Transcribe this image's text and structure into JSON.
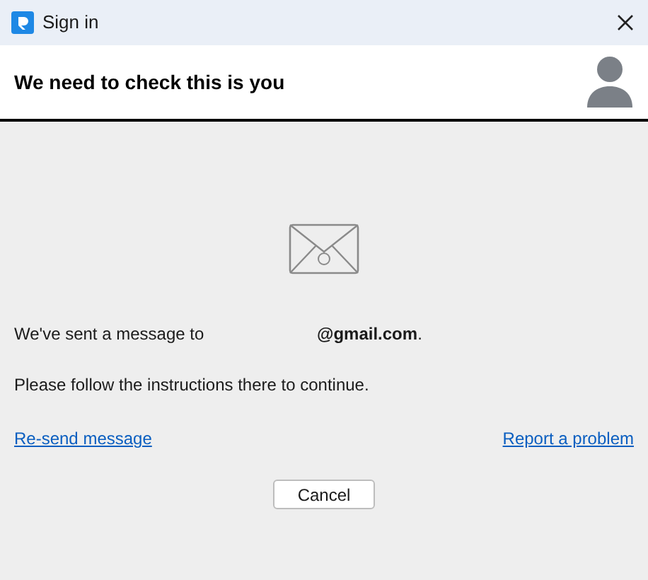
{
  "window": {
    "title": "Sign in"
  },
  "header": {
    "title": "We need to check this is you"
  },
  "message": {
    "prefix": "We've sent a message to",
    "email": "**@gmail.com**."
  },
  "instruction": "Please follow the instructions there to continue.",
  "links": [
    {
      "label": "Re-send message"
    },
    {
      "label": "Report a problem"
    }
  ],
  "buttons": [
    {
      "label": "Cancel"
    }
  ]
}
